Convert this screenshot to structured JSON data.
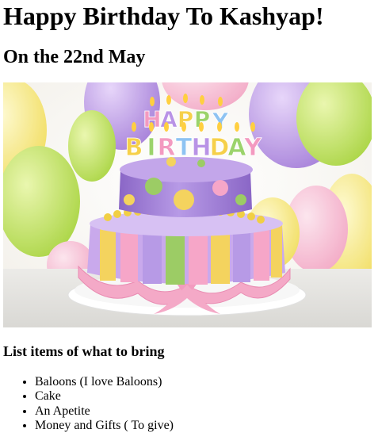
{
  "heading": "Happy Birthday To Kashyap!",
  "date_line": "On the 22nd May",
  "image": {
    "alt": "Birthday cake",
    "topper_text": "HAPPY BIRTHDAY"
  },
  "list_heading": "List items of what to bring",
  "items": [
    {
      "label": "Baloons (I love Baloons)"
    },
    {
      "label": "Cake"
    },
    {
      "label": "An Apetite"
    },
    {
      "label": "Money and Gifts ( To give)"
    }
  ],
  "colors": {
    "cake_purple": "#a78bd6",
    "cake_pink": "#f6a6c8",
    "cake_yellow": "#f4d35e",
    "cake_green": "#9ccc65",
    "balloon_green": "#b8e05a",
    "balloon_purple": "#b48ae6"
  }
}
